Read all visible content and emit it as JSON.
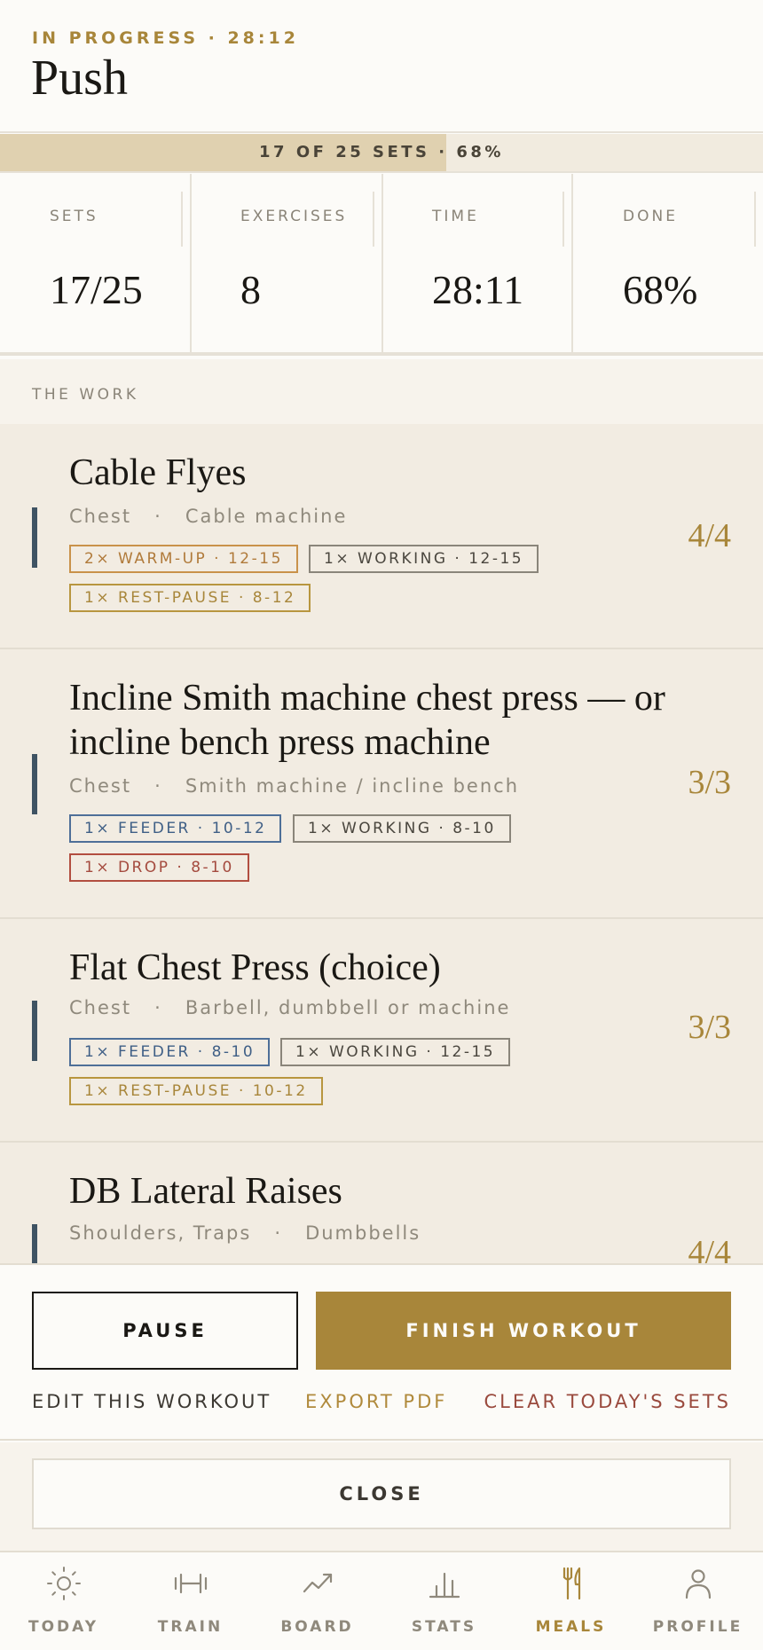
{
  "header": {
    "status": "IN PROGRESS · 28:12",
    "title": "Push"
  },
  "progress": {
    "text": "17 OF 25 SETS · 68%",
    "fraction": 0.68
  },
  "stats": [
    {
      "label": "SETS",
      "value": "17/25"
    },
    {
      "label": "EXERCISES",
      "value": "8"
    },
    {
      "label": "TIME",
      "value": "28:11"
    },
    {
      "label": "DONE",
      "value": "68%"
    }
  ],
  "section": {
    "label": "THE WORK"
  },
  "exercises": [
    {
      "name": "Cable Flyes",
      "muscle": "Chest",
      "equipment": "Cable machine",
      "count": "4/4",
      "tags": [
        "2× WARM-UP · 12-15",
        "1× WORKING · 12-15",
        "1× REST-PAUSE · 8-12"
      ]
    },
    {
      "name_line1": "Incline Smith machine chest press — or",
      "name_line2": "incline bench press machine",
      "muscle": "Chest",
      "equipment": "Smith machine / incline bench",
      "count": "3/3",
      "tags": [
        "1× FEEDER · 10-12",
        "1× WORKING · 8-10",
        "1× DROP · 8-10"
      ]
    },
    {
      "name": "Flat Chest Press (choice)",
      "muscle": "Chest",
      "equipment": "Barbell, dumbbell or machine",
      "count": "3/3",
      "tags": [
        "1× FEEDER · 8-10",
        "1× WORKING · 12-15",
        "1× REST-PAUSE · 10-12"
      ]
    },
    {
      "name": "DB Lateral Raises",
      "muscle": "Shoulders, Traps",
      "equipment": "Dumbbells",
      "count": "4/4"
    }
  ],
  "meta_separator": "·",
  "actions": {
    "pause": "PAUSE",
    "finish": "FINISH WORKOUT",
    "edit": "EDIT THIS WORKOUT",
    "export": "EXPORT PDF",
    "clear": "CLEAR TODAY'S SETS",
    "close": "CLOSE"
  },
  "nav": [
    {
      "label": "TODAY",
      "icon": "sun-icon"
    },
    {
      "label": "TRAIN",
      "icon": "dumbbell-icon"
    },
    {
      "label": "BOARD",
      "icon": "trend-icon"
    },
    {
      "label": "STATS",
      "icon": "bar-chart-icon"
    },
    {
      "label": "MEALS",
      "icon": "fork-knife-icon",
      "active": true
    },
    {
      "label": "PROFILE",
      "icon": "person-icon"
    }
  ],
  "colors": {
    "accent": "#a8863a",
    "progress_fill": "#e0d1b0",
    "card_bg": "#f2ece2",
    "bar": "#3f5363",
    "feeder": "#4e6f98",
    "drop": "#b24e40"
  }
}
